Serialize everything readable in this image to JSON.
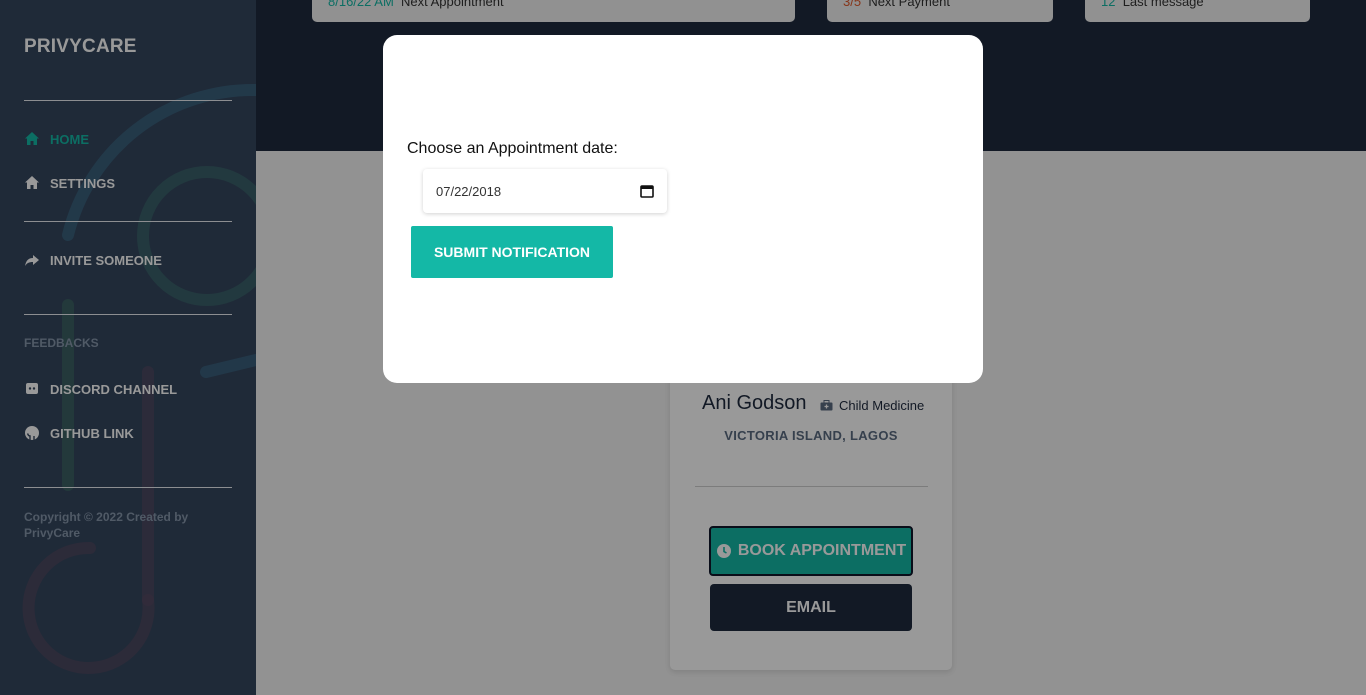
{
  "sidebar": {
    "brand": "PRIVYCARE",
    "nav": [
      {
        "label": "HOME",
        "icon": "home-icon",
        "active": true
      },
      {
        "label": "SETTINGS",
        "icon": "home-icon",
        "active": false
      },
      {
        "label": "INVITE SOMEONE",
        "icon": "share-icon",
        "active": false
      }
    ],
    "feedback_section": "FEEDBACKS",
    "feedback_links": [
      {
        "label": "DISCORD CHANNEL",
        "icon": "discord-icon"
      },
      {
        "label": "GITHUB LINK",
        "icon": "github-icon"
      }
    ],
    "copyright": "Copyright © 2022 Created by PrivyCare"
  },
  "stats": [
    {
      "value": "8/16/22 AM",
      "label": "Next Appointment",
      "value_color": "#14b8a6"
    },
    {
      "value": "3/5",
      "label": "Next Payment",
      "value_color": "#e0592a"
    },
    {
      "value": "12",
      "label": "Last message",
      "value_color": "#14b8a6"
    }
  ],
  "profile": {
    "name": "Ani Godson",
    "specialty": "Child Medicine",
    "location": "VICTORIA ISLAND, LAGOS",
    "book_label": "BOOK APPOINTMENT",
    "email_label": "EMAIL"
  },
  "modal": {
    "label": "Choose an Appointment date:",
    "date_value": "07/22/2018",
    "submit_label": "SUBMIT NOTIFICATION"
  },
  "colors": {
    "accent": "#14b8a6",
    "sidebar_bg": "#34465e",
    "dark": "#1f2a3e"
  }
}
